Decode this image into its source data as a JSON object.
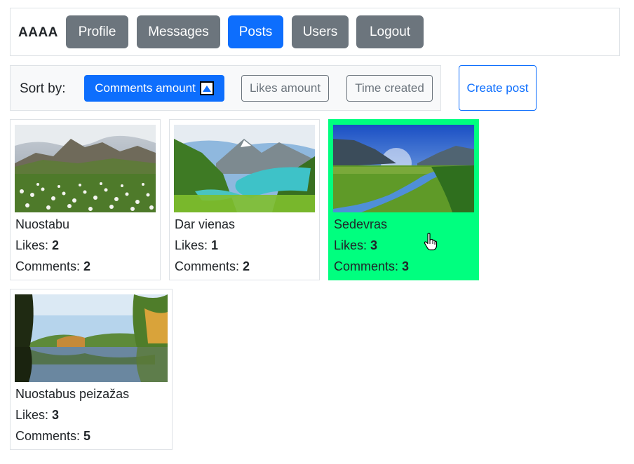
{
  "nav": {
    "brand": "AAAA",
    "items": [
      {
        "label": "Profile",
        "active": false
      },
      {
        "label": "Messages",
        "active": false
      },
      {
        "label": "Posts",
        "active": true
      },
      {
        "label": "Users",
        "active": false
      },
      {
        "label": "Logout",
        "active": false
      }
    ]
  },
  "sort": {
    "label": "Sort by:",
    "options": [
      {
        "label": "Comments amount",
        "active": true,
        "direction": "ascending"
      },
      {
        "label": "Likes amount",
        "active": false
      },
      {
        "label": "Time created",
        "active": false
      }
    ]
  },
  "create_post_label": "Create post",
  "stat_labels": {
    "likes": "Likes:",
    "comments": "Comments:"
  },
  "posts": [
    {
      "title": "Nuostabu",
      "likes": "2",
      "comments": "2",
      "highlighted": false
    },
    {
      "title": "Dar vienas",
      "likes": "1",
      "comments": "2",
      "highlighted": false
    },
    {
      "title": "Sedevras",
      "likes": "3",
      "comments": "3",
      "highlighted": true
    },
    {
      "title": "Nuostabus peizažas",
      "likes": "3",
      "comments": "5",
      "highlighted": false
    }
  ],
  "colors": {
    "primary": "#0d6efd",
    "secondary": "#6c757d",
    "highlight": "#00ff7f",
    "border": "#dee2e6"
  }
}
